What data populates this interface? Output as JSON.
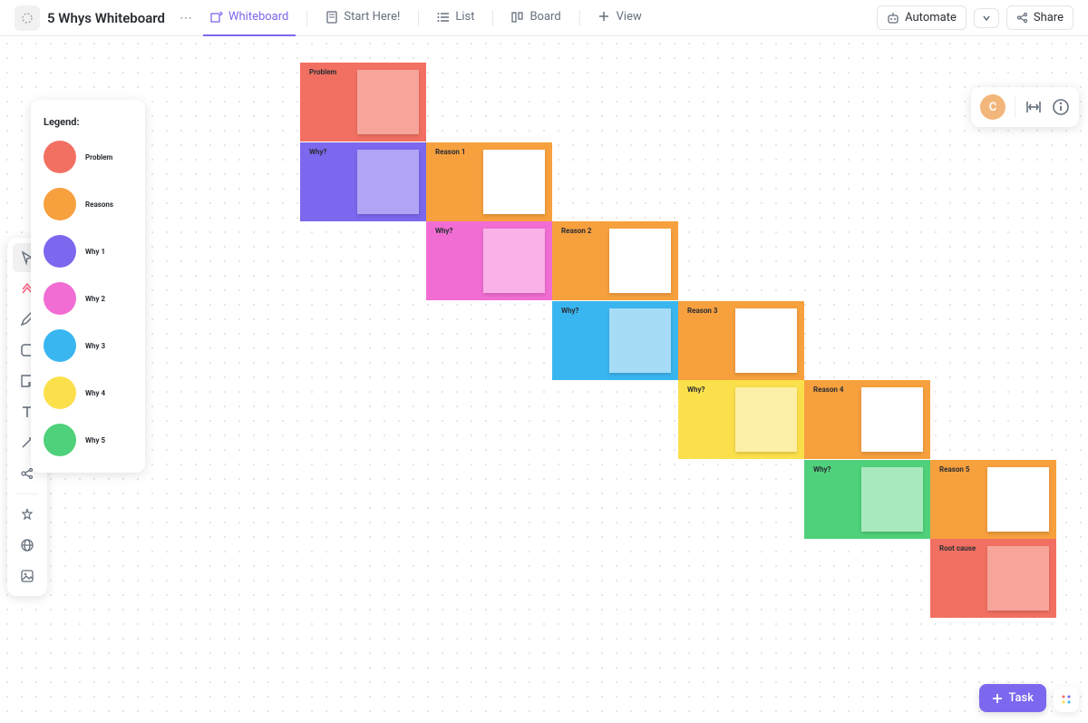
{
  "header": {
    "title": "5 Whys Whiteboard",
    "tabs": {
      "whiteboard": "Whiteboard",
      "start_here": "Start Here!",
      "list": "List",
      "board": "Board",
      "view": "View"
    },
    "automate": "Automate",
    "share": "Share"
  },
  "avatar": {
    "letter": "C"
  },
  "legend": {
    "title": "Legend:",
    "items": [
      {
        "label": "Problem",
        "color": "#f27062"
      },
      {
        "label": "Reasons",
        "color": "#f7a03e"
      },
      {
        "label": "Why 1",
        "color": "#7b68ee"
      },
      {
        "label": "Why 2",
        "color": "#f16dd3"
      },
      {
        "label": "Why 3",
        "color": "#39b6f0"
      },
      {
        "label": "Why 4",
        "color": "#fce04b"
      },
      {
        "label": "Why 5",
        "color": "#4fd17b"
      }
    ]
  },
  "cards": {
    "problem": {
      "label": "Problem",
      "bg": "#f27062",
      "note": "#f7a59b"
    },
    "why1": {
      "label": "Why?",
      "bg": "#7b68ee",
      "note": "#b1a4f5"
    },
    "reason1": {
      "label": "Reason 1",
      "bg": "#f7a03e",
      "note": "#ffffff"
    },
    "why2": {
      "label": "Why?",
      "bg": "#f16dd3",
      "note": "#f9b1e7"
    },
    "reason2": {
      "label": "Reason 2",
      "bg": "#f7a03e",
      "note": "#ffffff"
    },
    "why3": {
      "label": "Why?",
      "bg": "#39b6f0",
      "note": "#a7dcf6"
    },
    "reason3": {
      "label": "Reason 3",
      "bg": "#f7a03e",
      "note": "#ffffff"
    },
    "why4": {
      "label": "Why?",
      "bg": "#fce04b",
      "note": "#fdf0a6"
    },
    "reason4": {
      "label": "Reason 4",
      "bg": "#f7a03e",
      "note": "#ffffff"
    },
    "why5": {
      "label": "Why?",
      "bg": "#4fd17b",
      "note": "#a8eabd"
    },
    "reason5": {
      "label": "Reason 5",
      "bg": "#f7a03e",
      "note": "#ffffff"
    },
    "rootcause": {
      "label": "Root cause",
      "bg": "#f27062",
      "note": "#f7a59b"
    }
  },
  "task_button": "Task"
}
